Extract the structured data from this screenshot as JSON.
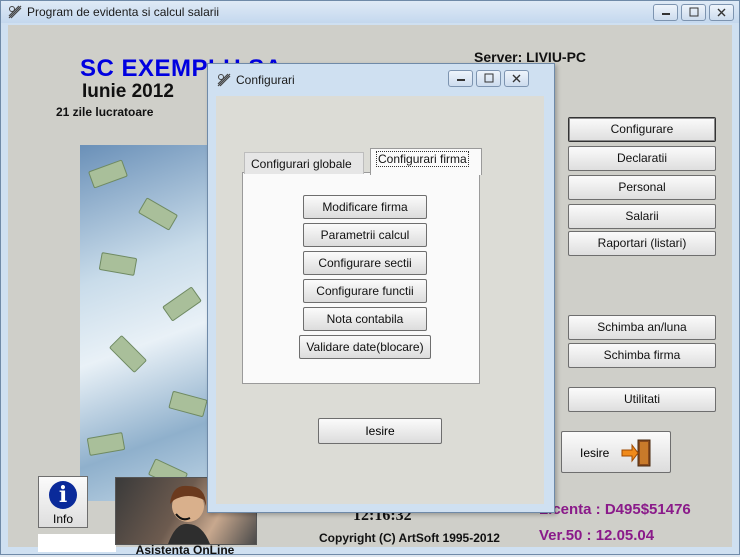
{
  "window": {
    "title": "Program de evidenta si calcul salarii"
  },
  "header": {
    "company": "SC EXEMPLU SA",
    "month": "Iunie 2012",
    "working_days": "21 zile lucratoare",
    "server": "Server: LIVIU-PC"
  },
  "side_buttons": [
    {
      "label": "Configurare"
    },
    {
      "label": "Declaratii"
    },
    {
      "label": "Personal"
    },
    {
      "label": "Salarii"
    },
    {
      "label": "Raportari (listari)"
    },
    {
      "label": "Schimba an/luna"
    },
    {
      "label": "Schimba firma"
    },
    {
      "label": "Utilitati"
    }
  ],
  "exit_main_label": "Iesire",
  "info_label": "Info",
  "support_label": "Asistenta OnLine",
  "clock": "12:16:32",
  "copyright": "Copyright (C) ArtSoft 1995-2012",
  "licenta": "Licenta :  D495$51476",
  "version": "Ver.50  :  12.05.04",
  "dialog": {
    "title": "Configurari",
    "tabs": [
      {
        "label": "Configurari globale"
      },
      {
        "label": "Configurari firma"
      }
    ],
    "buttons": [
      {
        "label": "Modificare firma"
      },
      {
        "label": "Parametrii calcul"
      },
      {
        "label": "Configurare sectii"
      },
      {
        "label": "Configurare functii"
      },
      {
        "label": "Nota contabila"
      },
      {
        "label": "Validare date(blocare)"
      }
    ],
    "exit_label": "Iesire"
  },
  "colors": {
    "company": "#0000e0",
    "license": "#8a1a8a",
    "titlebar": "#c4d8ee"
  },
  "icons": {
    "app": "app-icon",
    "info": "info-icon",
    "exit": "exit-door-icon"
  }
}
